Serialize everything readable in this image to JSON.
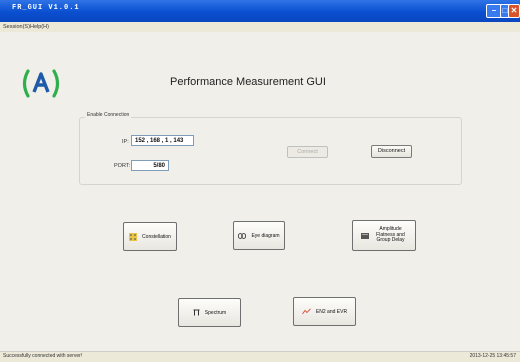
{
  "window": {
    "title": "FR_GUI V1.0.1",
    "min_glyph": "–",
    "max_glyph": "□",
    "close_glyph": "✕"
  },
  "menu": {
    "items": [
      "Session(S)",
      "Help(H)"
    ]
  },
  "page_title": "Performance Measurement GUI",
  "connection": {
    "group_label": "Enable Connection",
    "ip_label": "IP:",
    "ip_value": "152 , 168 , 1 , 143",
    "port_label": "PORT:",
    "port_value": "5/80",
    "connect_label": "Connect",
    "disconnect_label": "Disconnect"
  },
  "measurements": {
    "constellation": "Constellation",
    "eye_diagram": "Eye diagram",
    "amplitude_flatness": "Amplitude Flatness and Group Delay",
    "spectrum": "Spectrum",
    "ebno_evm": "EN2 and EVR"
  },
  "status": {
    "message": "Successfully connected with server!",
    "timestamp": "2013-12-25 13:45:57"
  },
  "colors": {
    "titlebar": "#0a4fd0",
    "logo_green": "#2fae4c",
    "logo_blue": "#1e5aa8"
  }
}
